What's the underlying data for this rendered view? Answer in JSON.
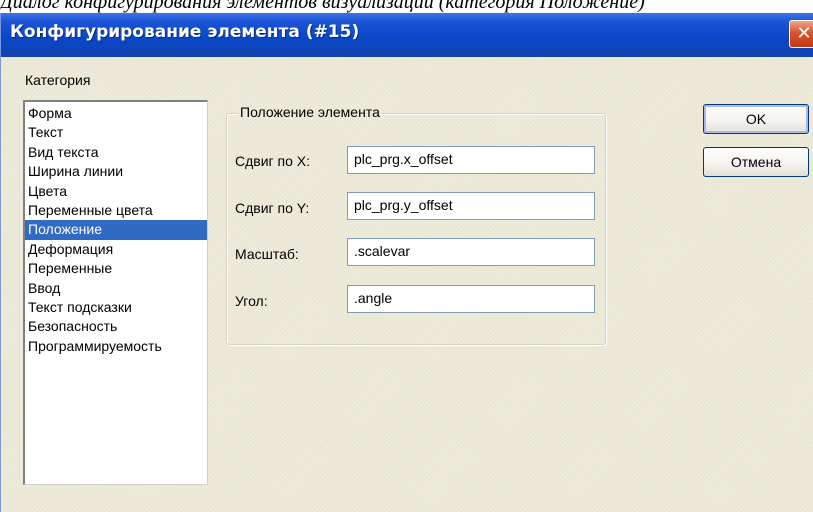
{
  "caption": "Диалог конфигурирования элементов визуализации (категория Положение)",
  "window": {
    "title": "Конфигурирование элемента (#15)",
    "close_glyph": "✕",
    "colors": {
      "titlebar": "#0a47c9",
      "face": "#ece9d8",
      "selection": "#316ac5",
      "close": "#d9532c"
    }
  },
  "category": {
    "label": "Категория",
    "items": [
      "Форма",
      "Текст",
      "Вид текста",
      "Ширина линии",
      "Цвета",
      "Переменные цвета",
      "Положение",
      "Деформация",
      "Переменные",
      "Ввод",
      "Текст подсказки",
      "Безопасность",
      "Программируемость"
    ],
    "selected": "Положение"
  },
  "position_group": {
    "title": "Положение элемента",
    "fields": [
      {
        "label": "Сдвиг по X:",
        "value": "plc_prg.x_offset"
      },
      {
        "label": "Сдвиг по Y:",
        "value": "plc_prg.y_offset"
      },
      {
        "label": "Масштаб:",
        "value": ".scalevar"
      },
      {
        "label": "Угол:",
        "value": ".angle"
      }
    ]
  },
  "buttons": {
    "ok": "OK",
    "cancel": "Отмена"
  }
}
